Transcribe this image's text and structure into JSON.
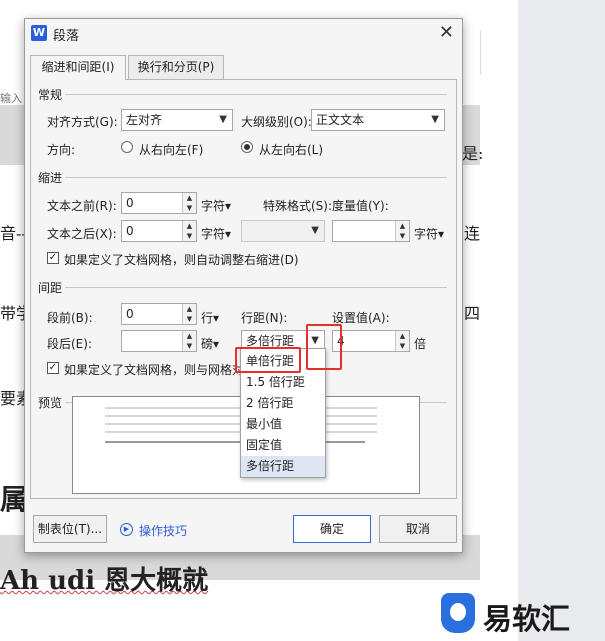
{
  "dialog": {
    "title": "段落",
    "app_icon": "W",
    "close_icon": "close-icon"
  },
  "tabs": [
    {
      "label": "缩进和间距(I)",
      "active": true
    },
    {
      "label": "换行和分页(P)",
      "active": false
    }
  ],
  "general": {
    "section": "常规",
    "alignment_label": "对齐方式(G):",
    "alignment_value": "左对齐",
    "outline_label": "大纲级别(O):",
    "outline_value": "正文文本",
    "direction_label": "方向:",
    "rtl_label": "从右向左(F)",
    "ltr_label": "从左向右(L)",
    "direction_selected": "ltr"
  },
  "indent": {
    "section": "缩进",
    "before_label": "文本之前(R):",
    "before_value": "0",
    "before_unit": "字符▾",
    "after_label": "文本之后(X):",
    "after_value": "0",
    "after_unit": "字符▾",
    "special_label": "特殊格式(S):",
    "special_value": "",
    "measure_label": "度量值(Y):",
    "measure_value": "",
    "measure_unit": "字符▾",
    "auto_adjust_label": "如果定义了文档网格，则自动调整右缩进(D)",
    "auto_adjust_checked": true
  },
  "spacing": {
    "section": "间距",
    "before_label": "段前(B):",
    "before_value": "0",
    "before_unit": "行▾",
    "after_label": "段后(E):",
    "after_value": "",
    "after_unit": "磅▾",
    "line_label": "行距(N):",
    "line_value": "多倍行距",
    "setting_label": "设置值(A):",
    "setting_value": "4",
    "setting_unit": "倍",
    "grid_label": "如果定义了文档网格，则与网格对齐(W)",
    "grid_checked": true
  },
  "preview": {
    "section": "预览"
  },
  "line_spacing_options": [
    "单倍行距",
    "1.5 倍行距",
    "2 倍行距",
    "最小值",
    "固定值",
    "多倍行距"
  ],
  "line_spacing_selected_index": 5,
  "footer": {
    "tabs_button": "制表位(T)...",
    "tips_label": "操作技巧",
    "ok_button": "确定",
    "cancel_button": "取消"
  },
  "background_doc": {
    "input_hint": "输入",
    "frag_1": "音--",
    "frag_2": "带学",
    "frag_3": "要素",
    "frag_4": "属",
    "frag_right_1": "是:",
    "frag_right_2": "连",
    "frag_right_3": "四",
    "bottom_text": "Ah udi 恩大概就"
  },
  "watermark": {
    "text": "易软汇"
  },
  "colors": {
    "accent": "#2b5fd9",
    "highlight": "#e0312b",
    "selected_item": "#dfe6f3"
  }
}
